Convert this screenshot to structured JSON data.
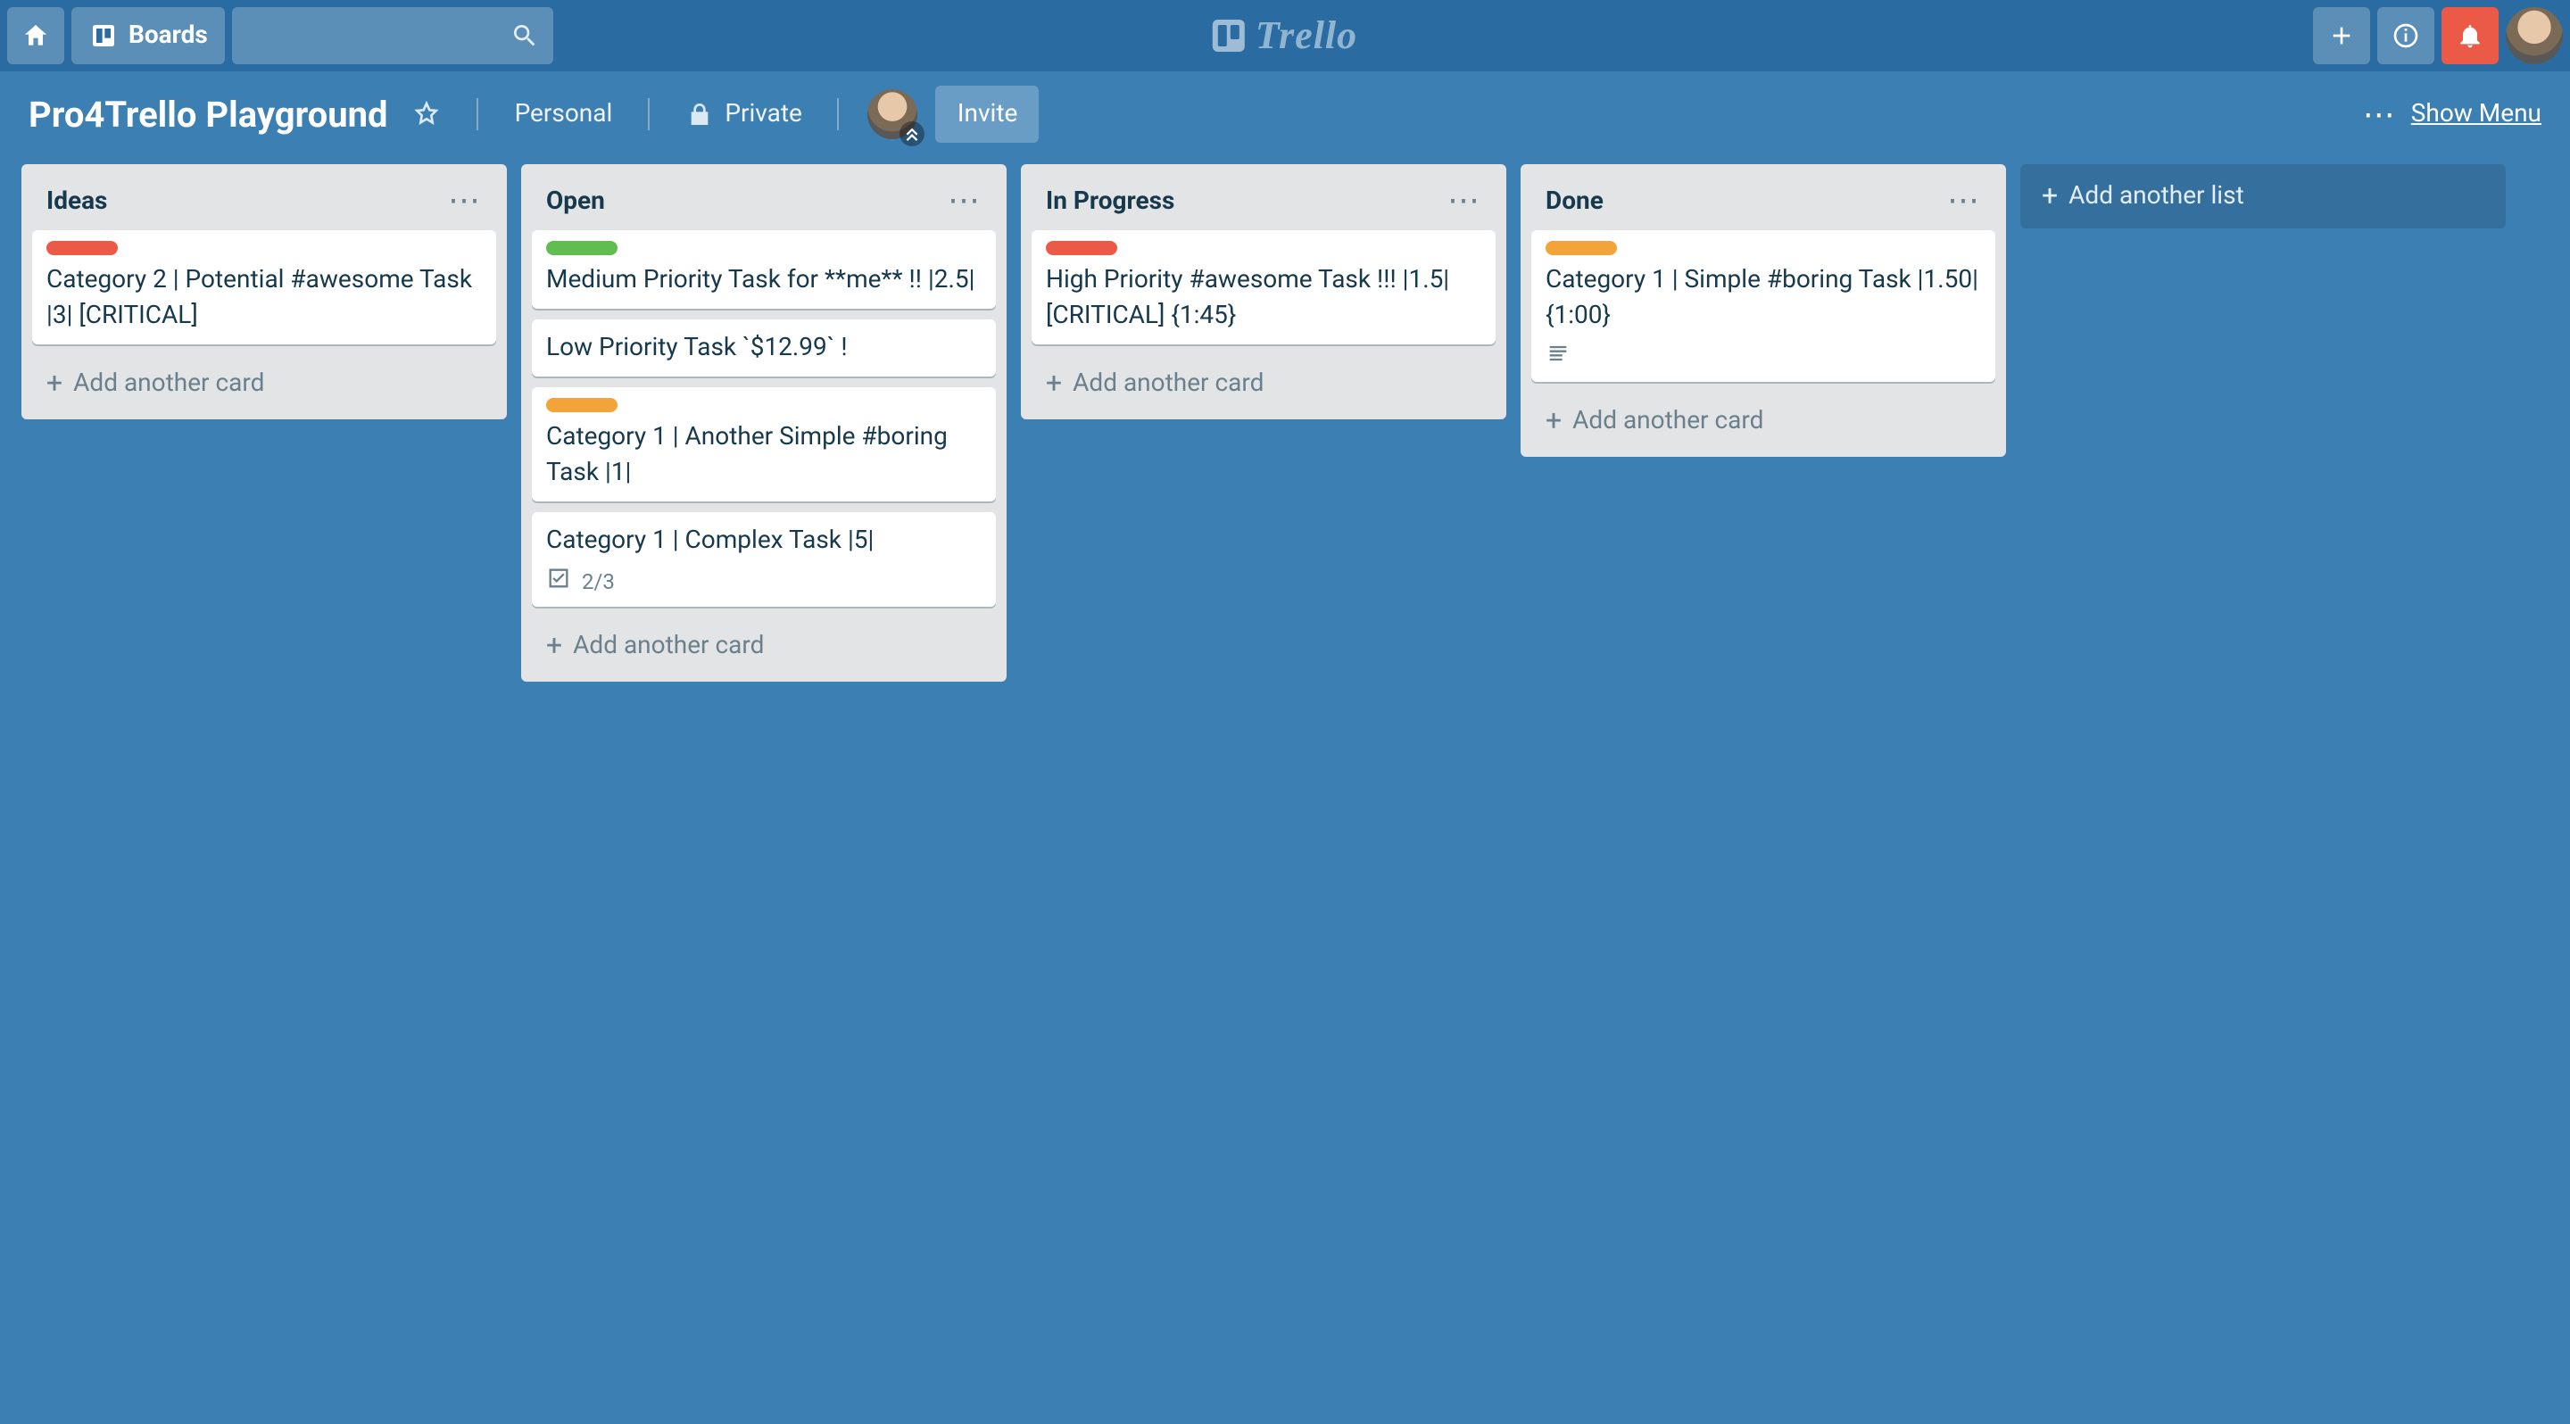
{
  "colors": {
    "label_red": "#eb5a46",
    "label_green": "#61bd4f",
    "label_orange": "#f2a33a"
  },
  "header": {
    "boards_label": "Boards",
    "logo_text": "Trello",
    "search_placeholder": ""
  },
  "board": {
    "title": "Pro4Trello Playground",
    "team": "Personal",
    "visibility": "Private",
    "invite_label": "Invite",
    "show_menu_label": "Show Menu",
    "add_card_label": "Add another card",
    "add_list_label": "Add another list"
  },
  "lists": [
    {
      "title": "Ideas",
      "cards": [
        {
          "label_color": "label_red",
          "title": "Category 2 | Potential #awesome Task |3| [CRITICAL]"
        }
      ]
    },
    {
      "title": "Open",
      "cards": [
        {
          "label_color": "label_green",
          "title": "Medium Priority Task for **me** !! |2.5|"
        },
        {
          "title": "Low Priority Task `$12.99` !"
        },
        {
          "label_color": "label_orange",
          "title": "Category 1 | Another Simple #boring Task |1|"
        },
        {
          "title": "Category 1 | Complex Task |5|",
          "checklist": "2/3"
        }
      ]
    },
    {
      "title": "In Progress",
      "cards": [
        {
          "label_color": "label_red",
          "title": "High Priority #awesome Task !!! |1.5| [CRITICAL] {1:45}"
        }
      ]
    },
    {
      "title": "Done",
      "cards": [
        {
          "label_color": "label_orange",
          "title": "Category 1 | Simple #boring Task |1.50| {1:00}",
          "has_description": true
        }
      ]
    }
  ]
}
